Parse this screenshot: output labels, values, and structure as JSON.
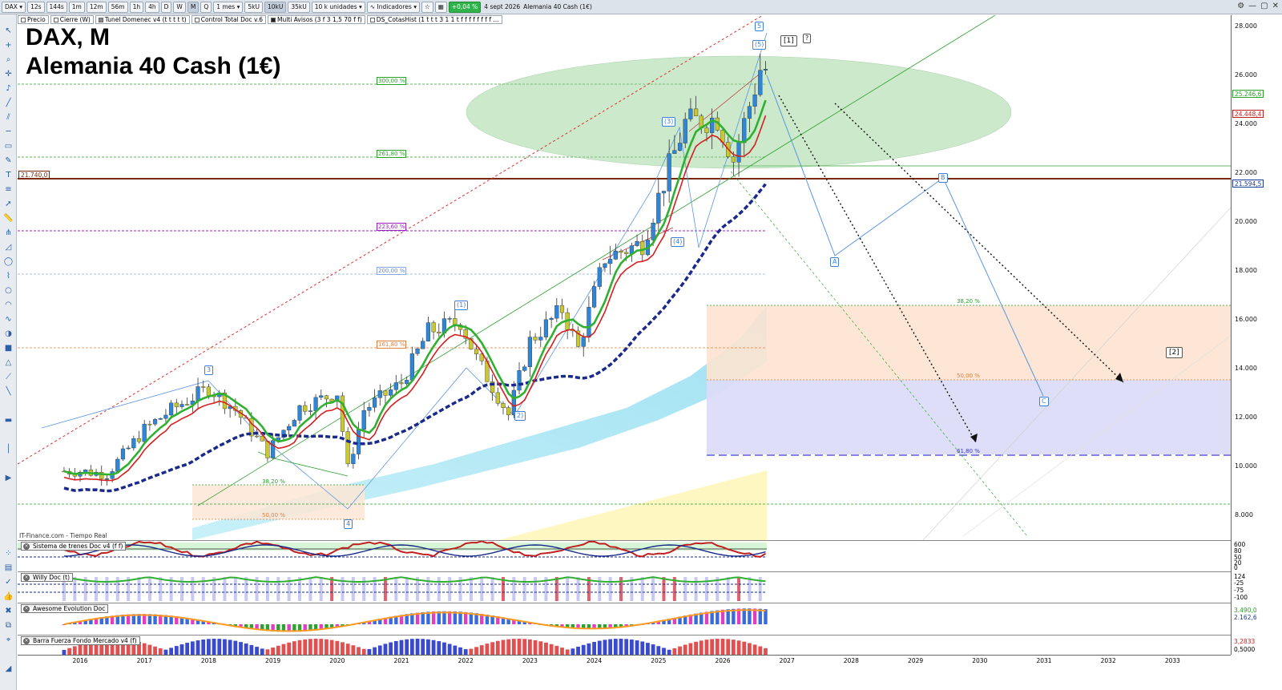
{
  "toolbar": {
    "symbol": "DAX",
    "timeframes": [
      "12s",
      "144s",
      "1m",
      "12m",
      "56m",
      "1h",
      "4h",
      "D",
      "W",
      "M",
      "Q"
    ],
    "active_timeframe": "M",
    "period": "1 mes",
    "units": [
      "5kU",
      "10kU",
      "35kU"
    ],
    "active_unit": "10kU",
    "unit_select": "10 k unidades",
    "indicators_label": "Indicadores",
    "change_badge": "+0,04 %",
    "date": "4 sept 2026",
    "instrument_name": "Alemania 40 Cash (1€)"
  },
  "chips": [
    "Precio",
    "Cierre (W)",
    "Tunel Domenec v4 (t t t t t)",
    "Control Total Doc v.6",
    "Multi Avisos (3 f 3 1,5 70 f f)",
    "DS_CotasHist (1 t t t 3 1 1 t f f f f f f f f ..."
  ],
  "titles": {
    "line1": "DAX, M",
    "line2": "Alemania 40 Cash (1€)"
  },
  "source": "IT-Finance.com - Tiempo Real",
  "price_axis": {
    "ticks": [
      "28.000",
      "26.000",
      "24.000",
      "22.000",
      "20.000",
      "18.000",
      "16.000",
      "14.000",
      "12.000",
      "10.000",
      "8.000"
    ],
    "tags": [
      {
        "text": "25.246,6",
        "color": "#2aa02a"
      },
      {
        "text": "24.448,4",
        "color": "#c02020"
      },
      {
        "text": "21.594,5",
        "color": "#1a3a9a"
      }
    ],
    "left_tag": "21.740,0"
  },
  "fib_levels": {
    "upper": [
      "300,00 %",
      "261,80 %",
      "223,60 %",
      "200,00 %",
      "161,80 %"
    ],
    "lower_left": [
      "38,20 %",
      "50,00 %"
    ],
    "lower_right": [
      "38,20 %",
      "50,00 %",
      "61,80 %"
    ]
  },
  "wave_labels": {
    "five": "5",
    "three": "3",
    "four": "4",
    "w1": "(1)",
    "w2": "2)",
    "w3": "(3)",
    "w4": "(4)",
    "w5": "(5)",
    "a": "A",
    "b": "B",
    "c": "C",
    "br1": "[1]",
    "br2": "[2]",
    "q": "?"
  },
  "panes": [
    {
      "label": "Sistema de trenes Doc v4 (f f)",
      "axis": [
        "600",
        "80",
        "50",
        "20",
        "0"
      ]
    },
    {
      "label": "Willy Doc (t)",
      "axis": [
        "124",
        "-25",
        "-75",
        "-100"
      ]
    },
    {
      "label": "Awesome Evolution Doc",
      "axis": [
        "3.490,0",
        "2.162,6"
      ]
    },
    {
      "label": "Barra Fuerza Fondo Mercado v4 (f)",
      "axis": [
        "3,2833",
        "0,5000"
      ]
    }
  ],
  "time_axis": [
    "2016",
    "2017",
    "2018",
    "2019",
    "2020",
    "2021",
    "2022",
    "2023",
    "2024",
    "2025",
    "2026",
    "2027",
    "2028",
    "2029",
    "2030",
    "2031",
    "2032",
    "2033"
  ],
  "colors": {
    "bull_candle": "#2f86d6",
    "bear_candle": "#c8c830",
    "ma_fast": "#30b030",
    "ma_red": "#d42020",
    "ma_blue": "#1a2a8a",
    "fib_green": "#2aa02a",
    "fib_purple": "#9a20c0"
  },
  "chart_data": {
    "type": "candlestick",
    "instrument": "DAX",
    "timeframe": "Monthly",
    "x_range": [
      "2015-06",
      "2034-01"
    ],
    "ylim": [
      7000,
      28500
    ],
    "approx_monthly_closes": {
      "2016-01": 9800,
      "2016-06": 9680,
      "2017-01": 11500,
      "2017-06": 12300,
      "2018-01": 13200,
      "2018-06": 12300,
      "2018-12": 10560,
      "2019-06": 12400,
      "2020-01": 13000,
      "2020-03": 9900,
      "2020-06": 12300,
      "2021-01": 13400,
      "2021-06": 15500,
      "2021-12": 15900,
      "2022-03": 14400,
      "2022-09": 12100,
      "2023-01": 15100,
      "2023-07": 16400,
      "2023-10": 14800,
      "2024-03": 18500,
      "2024-10": 19100,
      "2025-03": 22200,
      "2025-06": 24000,
      "2025-12": 24200,
      "2026-03": 22500,
      "2026-08": 26200
    },
    "horizontal_levels": [
      21740,
      22300,
      16600,
      13600,
      10400,
      8500
    ],
    "grid": false
  }
}
